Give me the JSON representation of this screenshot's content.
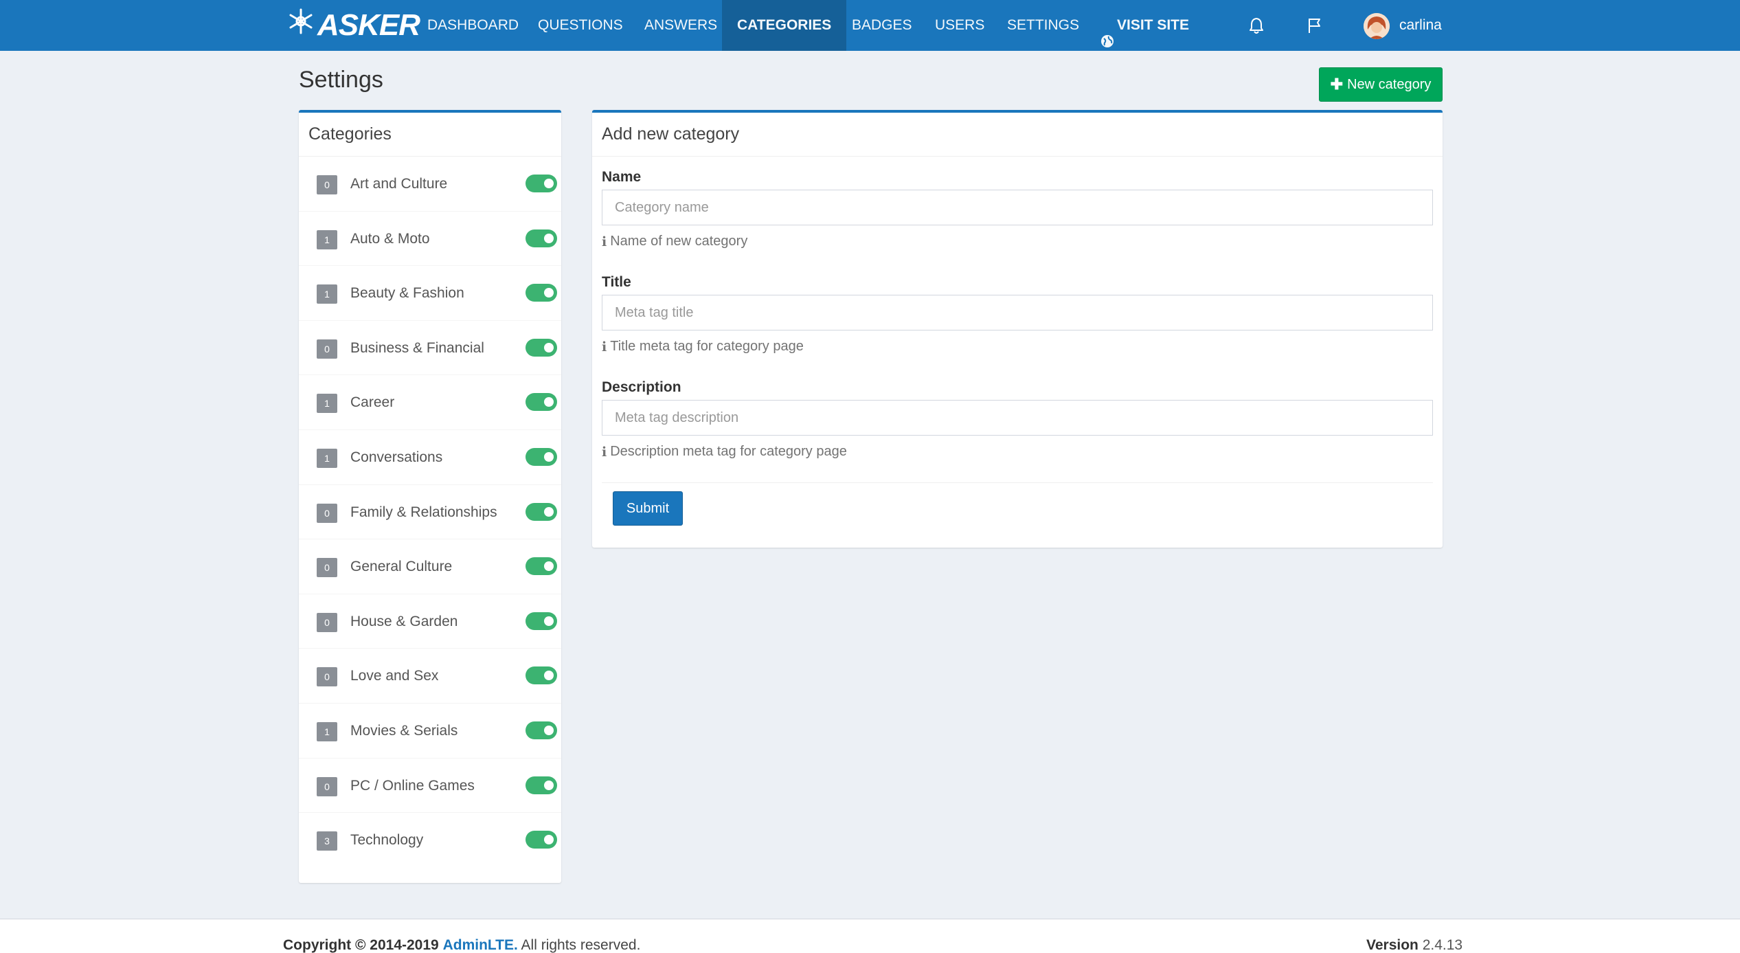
{
  "brand": {
    "logo_text": "ASKER"
  },
  "nav": {
    "items": [
      {
        "label": "DASHBOARD"
      },
      {
        "label": "QUESTIONS"
      },
      {
        "label": "ANSWERS"
      },
      {
        "label": "CATEGORIES"
      },
      {
        "label": "BADGES"
      },
      {
        "label": "USERS"
      },
      {
        "label": "SETTINGS"
      }
    ],
    "visit_site": "VISIT SITE",
    "username": "carlina"
  },
  "page": {
    "title": "Settings",
    "new_category_label": "New category"
  },
  "categories": {
    "title": "Categories",
    "items": [
      {
        "count": "0",
        "name": "Art and Culture",
        "enabled": true
      },
      {
        "count": "1",
        "name": "Auto & Moto",
        "enabled": true
      },
      {
        "count": "1",
        "name": "Beauty & Fashion",
        "enabled": true
      },
      {
        "count": "0",
        "name": "Business & Financial",
        "enabled": true
      },
      {
        "count": "1",
        "name": "Career",
        "enabled": true
      },
      {
        "count": "1",
        "name": "Conversations",
        "enabled": true
      },
      {
        "count": "0",
        "name": "Family & Relationships",
        "enabled": true
      },
      {
        "count": "0",
        "name": "General Culture",
        "enabled": true
      },
      {
        "count": "0",
        "name": "House & Garden",
        "enabled": true
      },
      {
        "count": "0",
        "name": "Love and Sex",
        "enabled": true
      },
      {
        "count": "1",
        "name": "Movies & Serials",
        "enabled": true
      },
      {
        "count": "0",
        "name": "PC / Online Games",
        "enabled": true
      },
      {
        "count": "3",
        "name": "Technology",
        "enabled": true
      }
    ]
  },
  "form": {
    "title": "Add new category",
    "name": {
      "label": "Name",
      "placeholder": "Category name",
      "help": "Name of new category"
    },
    "meta_title": {
      "label": "Title",
      "placeholder": "Meta tag title",
      "help": "Title meta tag for category page"
    },
    "description": {
      "label": "Description",
      "placeholder": "Meta tag description",
      "help": "Description meta tag for category page"
    },
    "submit_label": "Submit"
  },
  "footer": {
    "copyright_prefix": "Copyright © 2014-2019",
    "brand_link": "AdminLTE.",
    "rights": "All rights reserved.",
    "version_label": "Version",
    "version_value": "2.4.13"
  },
  "colors": {
    "navbar": "#1a76bc",
    "success": "#00a65a",
    "toggle_on": "#3cb371",
    "background": "#ecf0f5"
  }
}
